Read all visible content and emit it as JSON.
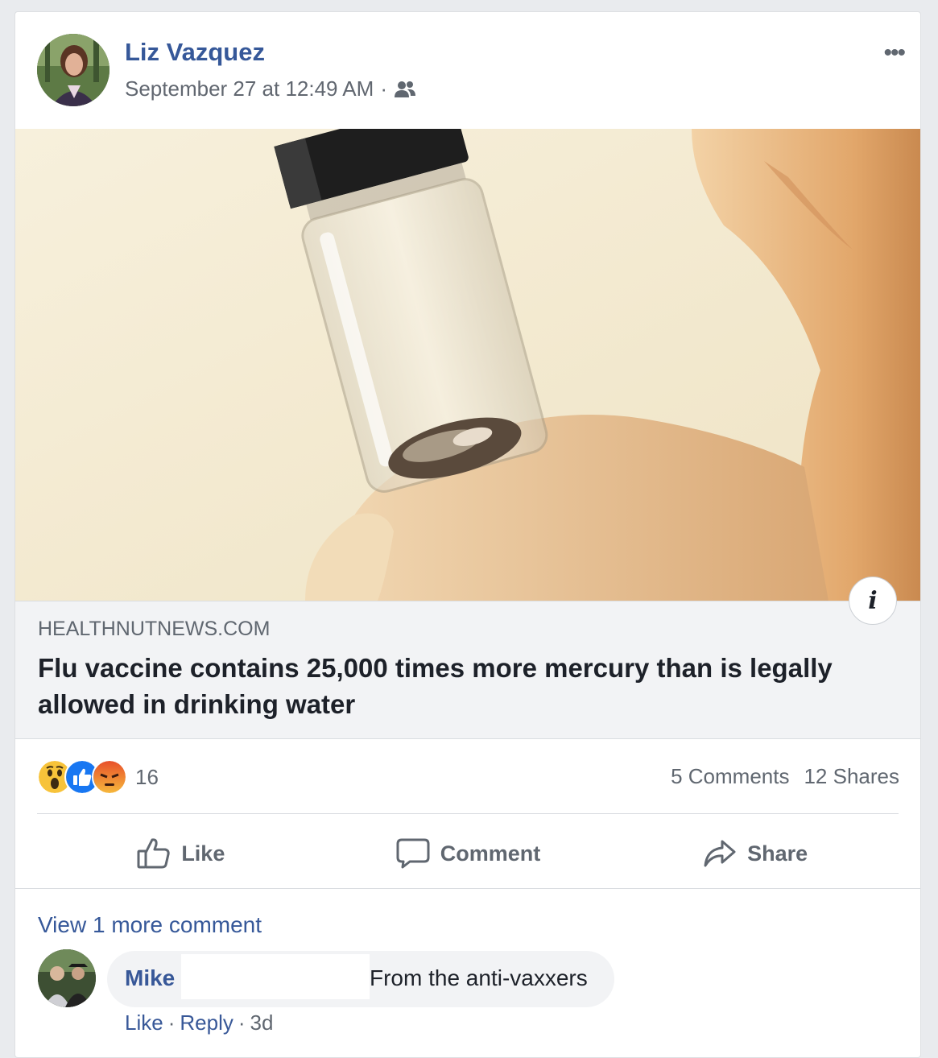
{
  "post": {
    "author": "Liz Vazquez",
    "timestamp": "September 27 at 12:49 AM",
    "separator": "·",
    "audience_icon": "friends-icon",
    "more_icon": "more-horizontal-icon",
    "more_glyph": "•••"
  },
  "link": {
    "domain": "HEALTHNUTNEWS.COM",
    "headline": "Flu vaccine contains 25,000 times more mercury than is legally allowed in drinking water",
    "info_label": "i"
  },
  "reactions": {
    "icons": [
      "wow-icon",
      "like-icon",
      "angry-icon"
    ],
    "count": "16",
    "comments": "5 Comments",
    "shares": "12 Shares"
  },
  "actions": {
    "like": "Like",
    "comment": "Comment",
    "share": "Share"
  },
  "comments": {
    "view_more": "View 1 more comment",
    "items": [
      {
        "name": "Mike",
        "text": "From the anti-vaxxers",
        "like": "Like",
        "reply": "Reply",
        "age": "3d",
        "sep": "·"
      }
    ]
  },
  "colors": {
    "link_blue": "#365899",
    "meta_gray": "#606770",
    "like_blue": "#1877f2",
    "angry_orange": "#f0642a",
    "wow_yellow": "#f7c33a"
  }
}
